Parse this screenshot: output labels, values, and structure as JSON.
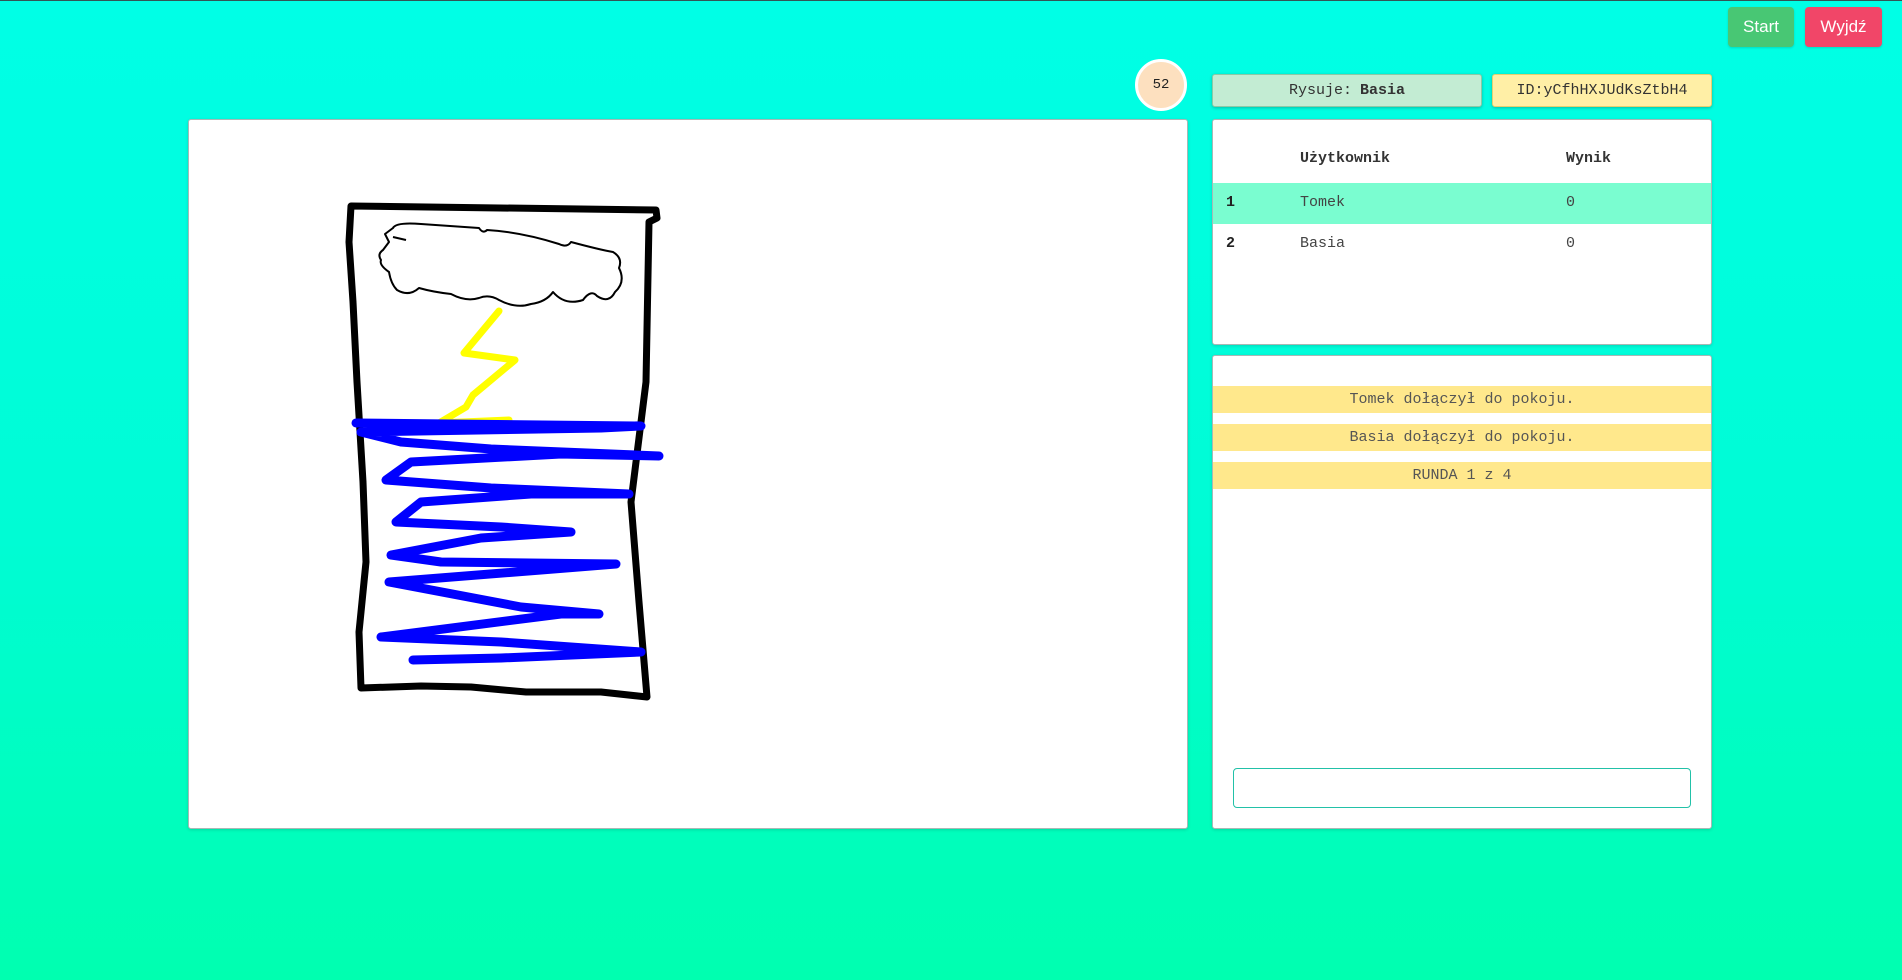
{
  "toolbar": {
    "start_label": "Start",
    "exit_label": "Wyjdź"
  },
  "game": {
    "timer": "52",
    "drawer_label": "Rysuje:",
    "drawer_name": "Basia",
    "room_id": "ID:yCfhHXJUdKsZtbH4"
  },
  "scoreboard": {
    "header_user": "Użytkownik",
    "header_score": "Wynik",
    "rows": [
      {
        "rank": "1",
        "user": "Tomek",
        "score": "0",
        "highlighted": true
      },
      {
        "rank": "2",
        "user": "Basia",
        "score": "0",
        "highlighted": false
      }
    ]
  },
  "chat": {
    "messages": [
      "Tomek dołączył do pokoju.",
      "Basia dołączył do pokoju.",
      "RUNDA 1 z 4"
    ],
    "input_value": ""
  },
  "colors": {
    "start": "#48c774",
    "exit": "#f14668",
    "highlight_row": "#7afdd0",
    "system_message": "#ffe88c",
    "stroke_black": "#000000",
    "stroke_yellow": "#ffff00",
    "stroke_blue": "#0000ff"
  }
}
